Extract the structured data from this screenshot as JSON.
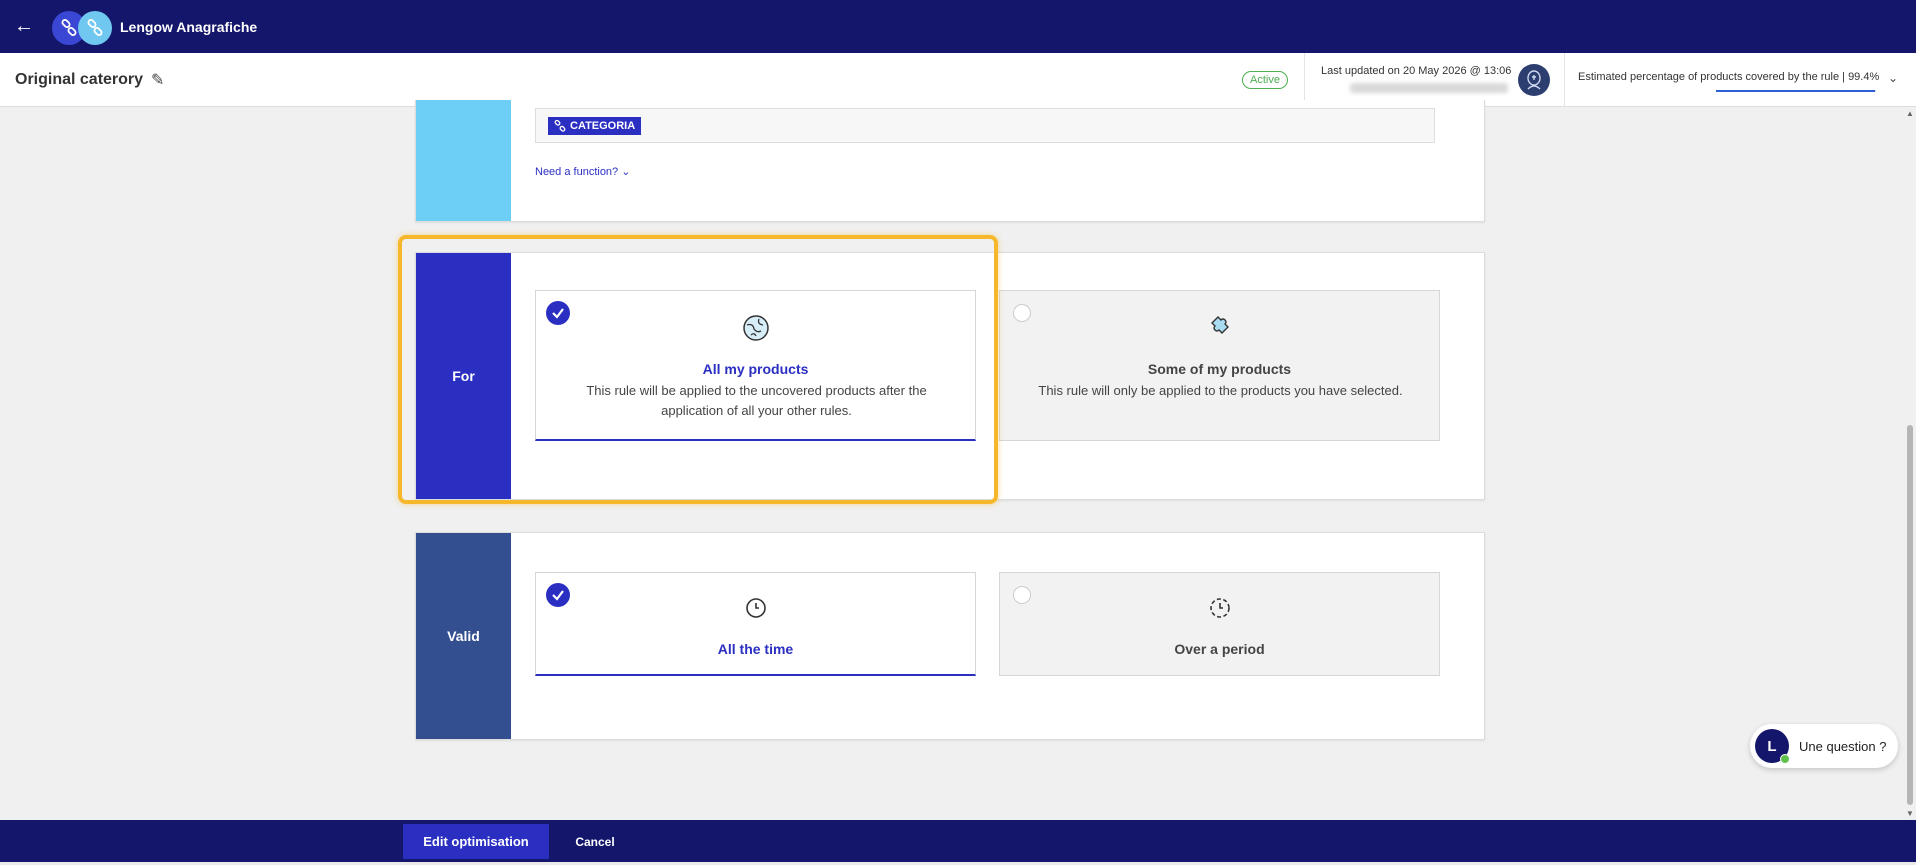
{
  "app": {
    "title": "Lengow Anagrafiche"
  },
  "header": {
    "rule_name": "Original caterory",
    "status": "Active",
    "last_updated": "Last updated on 20 May 2026 @ 13:06",
    "coverage_label": "Estimated percentage of products covered by the rule | 99.4%",
    "coverage_value": 0.994
  },
  "formula": {
    "tag_label": "CATEGORIA",
    "need_function": "Need a function?"
  },
  "for_section": {
    "label": "For",
    "options": [
      {
        "title": "All my products",
        "description": "This rule will be applied to the uncovered products after the application of all your other rules.",
        "selected": true
      },
      {
        "title": "Some of my products",
        "description": "This rule will only be applied to the products you have selected.",
        "selected": false
      }
    ]
  },
  "valid_section": {
    "label": "Valid",
    "options": [
      {
        "title": "All the time",
        "selected": true
      },
      {
        "title": "Over a period",
        "selected": false
      }
    ]
  },
  "chat": {
    "label": "Une question ?",
    "logo_letter": "L"
  },
  "footer": {
    "edit_label": "Edit optimisation",
    "cancel_label": "Cancel"
  },
  "colors": {
    "navy": "#14166b",
    "accent": "#2a2fc2",
    "light_blue": "#6dcff6",
    "valid_blue": "#344f8f",
    "highlight": "#f6b72a",
    "active_green": "#4caf50"
  }
}
